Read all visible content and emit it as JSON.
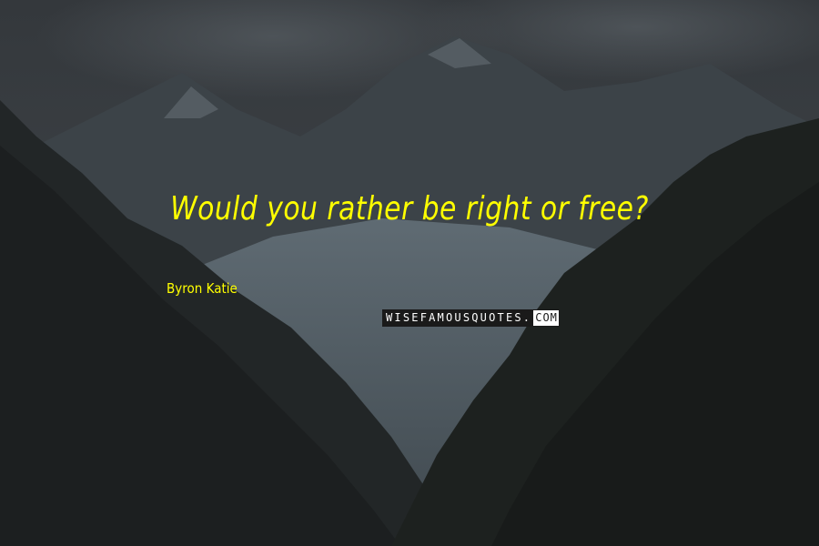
{
  "quote": {
    "text": "Would you rather be right or free?",
    "author": "Byron Katie",
    "color": "#ffff00"
  },
  "watermark": {
    "main": "WISEFAMOUSQUOTES.",
    "end": "COM"
  },
  "background": {
    "description_colors": {
      "sky": "#3a3f44",
      "mountain_far": "#4a5258",
      "glacier": "#5d6a72",
      "cliff_left": "#1f2324",
      "cliff_right": "#1b1f1d"
    }
  }
}
